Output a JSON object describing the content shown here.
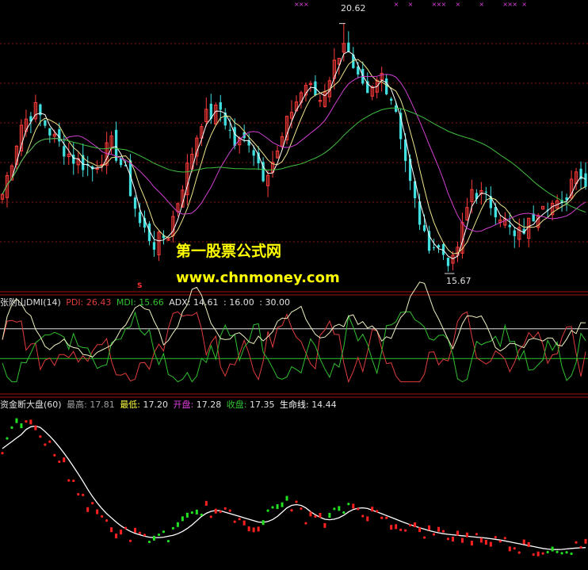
{
  "colors": {
    "background": "#000000",
    "up": "#ff3b3b",
    "down": "#40e0e0",
    "pdi": "#e03c3c",
    "mdi": "#30c030",
    "adx": "#f0f0c0",
    "ma_white": "#ffffff",
    "ma_yellow": "#f0e68c",
    "ma_magenta": "#d040d0",
    "ma_green": "#40c040",
    "separator": "#a01010",
    "grid": "#8b1010",
    "watermark": "#ffff00",
    "green_dot": "#20e020",
    "red_dot": "#ff2020"
  },
  "main_panel": {
    "high_label": "20.62",
    "low_label": "15.67",
    "s_mark": "S",
    "watermark_title": "第一股票公式网",
    "watermark_url": "www.chnmoney.com"
  },
  "dmi_panel": {
    "name": "张附山DMI(14)",
    "pdi_label": "PDI:",
    "pdi_value": "26.43",
    "mdi_label": "MDI:",
    "mdi_value": "15.66",
    "adx_label": "ADX:",
    "adx_value": "14.61",
    "ref1": "16.00",
    "ref2": "30.00",
    "sep": ":"
  },
  "gold_panel": {
    "name": "资金断大盘(60)",
    "high_label": "最高:",
    "high_value": "17.81",
    "low_label": "最低:",
    "low_value": "17.20",
    "open_label": "开盘:",
    "open_value": "17.28",
    "close_label": "收盘:",
    "close_value": "17.35",
    "life_label": "生命线:",
    "life_value": "14.44"
  },
  "chart_data": {
    "type": "candlestick",
    "price_range": [
      15.4,
      20.9
    ],
    "candle_count": 124,
    "dmi_range": [
      0,
      40
    ],
    "dmi_reference_lines": [
      16,
      30
    ],
    "gold_range": [
      13.5,
      19.0
    ]
  }
}
